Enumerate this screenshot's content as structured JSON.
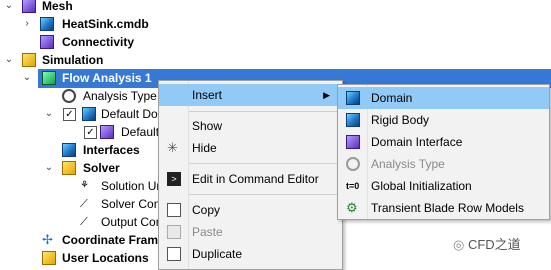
{
  "tree": {
    "mesh": "Mesh",
    "heatsink": "HeatSink.cmdb",
    "connectivity": "Connectivity",
    "simulation": "Simulation",
    "flow_analysis": "Flow Analysis 1",
    "analysis_type": "Analysis Type",
    "default_domain": "Default Dom",
    "default_sub": "Default",
    "interfaces": "Interfaces",
    "solver": "Solver",
    "solution_units": "Solution Uni",
    "solver_control": "Solver Cont",
    "output_control": "Output Con",
    "coordinate_frames": "Coordinate Frame",
    "user_locations": "User Locations"
  },
  "context_menu": {
    "insert": "Insert",
    "show": "Show",
    "hide": "Hide",
    "edit_command": "Edit in Command Editor",
    "copy": "Copy",
    "paste": "Paste",
    "duplicate": "Duplicate"
  },
  "submenu": {
    "domain": "Domain",
    "rigid_body": "Rigid Body",
    "domain_interface": "Domain Interface",
    "analysis_type": "Analysis Type",
    "global_init": "Global Initialization",
    "transient_blade": "Transient Blade Row Models"
  },
  "watermark": "CFD之道",
  "icons": [
    "mesh-icon",
    "file-icon",
    "connectivity-icon",
    "simulation-icon",
    "flow-analysis-icon",
    "clock-icon",
    "domain-icon",
    "interfaces-icon",
    "solver-icon",
    "units-icon",
    "solver-control-icon",
    "output-control-icon",
    "coordinate-frame-icon",
    "user-locations-icon",
    "rigid-body-icon",
    "domain-interface-icon",
    "global-init-icon",
    "blade-row-icon",
    "command-editor-icon",
    "copy-icon",
    "paste-icon",
    "duplicate-icon",
    "hide-icon"
  ],
  "colors": {
    "selection": "#3578d6",
    "menu_highlight": "#91c9f7",
    "menu_bg": "#f2f2f2"
  }
}
